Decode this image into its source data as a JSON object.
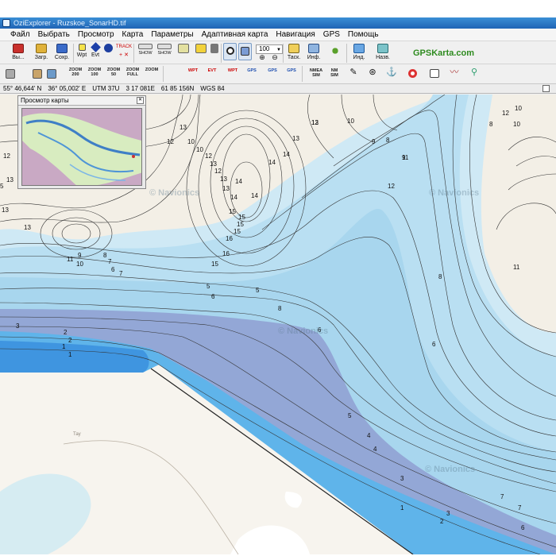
{
  "window": {
    "title": "OziExplorer - Ruzskoe_SonarHD.tif"
  },
  "menu": [
    "Файл",
    "Выбрать",
    "Просмотр",
    "Карта",
    "Параметры",
    "Адаптивная карта",
    "Навигация",
    "GPS",
    "Помощь"
  ],
  "toolbar1": {
    "exit_label": "Вы...",
    "load_label": "Загр.",
    "save_label": "Сохр.",
    "wpt_label": "Wpt",
    "evt_label": "Evt",
    "track_label": "TRACK",
    "show_label": "SHOW",
    "zoom_value": "100",
    "task_label": "Таск.",
    "info_label": "Инф.",
    "ind_label": "Инд.",
    "name_label": "Назв.",
    "brand": "GPSKarta.com"
  },
  "toolbar2": {
    "zoom_buttons": [
      "ZOOM\n200",
      "ZOOM\n100",
      "ZOOM\n50",
      "ZOOM\nFULL",
      "ZOOM\n"
    ],
    "small_labels": [
      "WPT",
      "EVT",
      "WPT",
      "GPS",
      "GPS",
      "GPS",
      "NMEA\nSIM",
      "NM\nSIM"
    ]
  },
  "status": {
    "lat": "55° 46,644' N",
    "lon": "36° 05,002' E",
    "utm": "UTM  37U",
    "east": "3 17 081E",
    "north": "61 85 156N",
    "datum": "WGS 84"
  },
  "preview": {
    "title": "Просмотр карты"
  },
  "map": {
    "watermark": "© Navionics",
    "road_label": "Тау",
    "colors": {
      "land": "#f3efe6",
      "water_shallow": "#cfe9f5",
      "water_mid": "#a8d6ee",
      "water_deep": "#5fb4ea",
      "water_deeper": "#3f95e0",
      "shoal": "#93a7d6",
      "green": "#c7dfa2"
    },
    "depth_labels": [
      "13",
      "12",
      "10",
      "10",
      "12",
      "13",
      "12",
      "13",
      "13",
      "14",
      "14",
      "14",
      "15",
      "15",
      "15",
      "15",
      "16",
      "16",
      "15",
      "14",
      "14",
      "13",
      "12",
      "10",
      "9",
      "8",
      "11",
      "12",
      "12",
      "13",
      "13",
      "13",
      "11",
      "10",
      "9",
      "8",
      "7",
      "6",
      "7",
      "5",
      "6",
      "5",
      "8",
      "6",
      "6",
      "11",
      "8",
      "3",
      "2",
      "2",
      "1",
      "1",
      "5",
      "4",
      "4",
      "3",
      "1",
      "3",
      "2",
      "7",
      "7",
      "6",
      "9",
      "8",
      "10",
      "10",
      "12",
      "5",
      "13"
    ]
  }
}
